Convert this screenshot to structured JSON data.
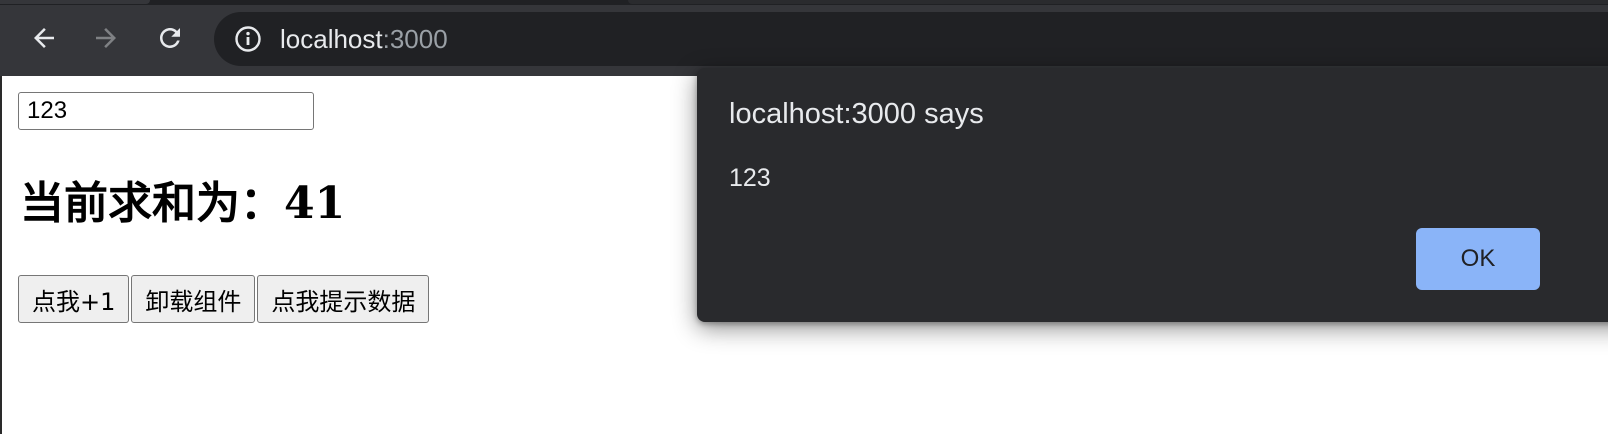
{
  "browser": {
    "url_host": "localhost",
    "url_port": ":3000",
    "icons": {
      "back": "arrow-left-icon",
      "forward": "arrow-right-icon",
      "reload": "reload-icon",
      "site_info": "info-icon"
    }
  },
  "page": {
    "input_value": "123",
    "sum_label": "当前求和为：",
    "sum_value": "41",
    "buttons": {
      "increment": "点我+1",
      "unmount": "卸载组件",
      "show_data": "点我提示数据"
    }
  },
  "dialog": {
    "title": "localhost:3000 says",
    "message": "123",
    "ok_label": "OK"
  },
  "colors": {
    "toolbar_bg": "#35363a",
    "omnibox_bg": "#202124",
    "dialog_bg": "#292a2d",
    "ok_button": "#8ab4f8"
  }
}
